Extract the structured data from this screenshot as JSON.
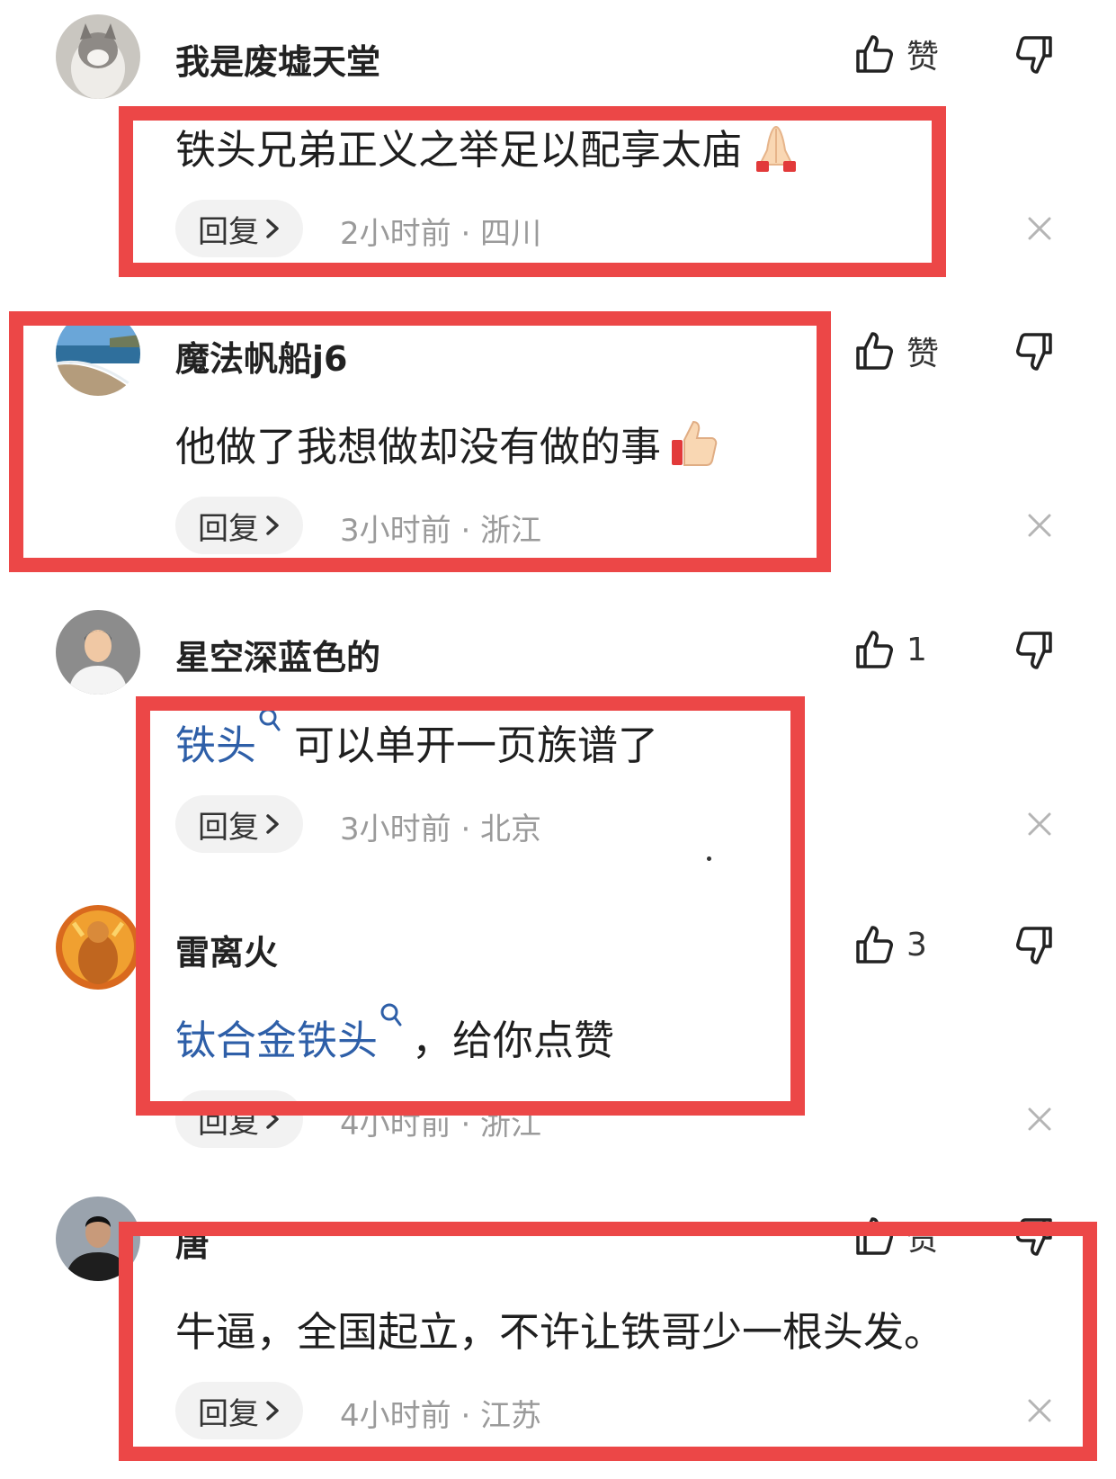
{
  "comments": [
    {
      "username": "我是废墟天堂",
      "avatar": "cat-avatar",
      "like_label": "赞",
      "text": "铁头兄弟正义之举足以配享太庙",
      "emoji": "folded-hands-emoji",
      "reply_label": "回复",
      "meta": "2小时前 · 四川"
    },
    {
      "username": "魔法帆船j6",
      "avatar": "beach-avatar",
      "like_label": "赞",
      "text": "他做了我想做却没有做的事",
      "emoji": "thumbs-up-emoji",
      "reply_label": "回复",
      "meta": "3小时前 · 浙江"
    },
    {
      "username": "星空深蓝色的",
      "avatar": "man-avatar",
      "like_label": "1",
      "link_text": "铁头",
      "text": "可以单开一页族谱了",
      "reply_label": "回复",
      "meta": "3小时前 · 北京"
    },
    {
      "username": "雷离火",
      "avatar": "statue-avatar",
      "like_label": "3",
      "link_text": "钛合金铁头",
      "text": "，给你点赞",
      "reply_label": "回复",
      "meta": "4小时前 · 浙江"
    },
    {
      "username": "唐",
      "avatar": "dark-portrait-avatar",
      "like_label": "赞",
      "text": "牛逼，全国起立，不许让铁哥少一根头发。",
      "reply_label": "回复",
      "meta": "4小时前 · 江苏"
    }
  ],
  "colors": {
    "highlight": "#ec4747",
    "link": "#2e5fa8",
    "meta": "#9a9a9a"
  }
}
